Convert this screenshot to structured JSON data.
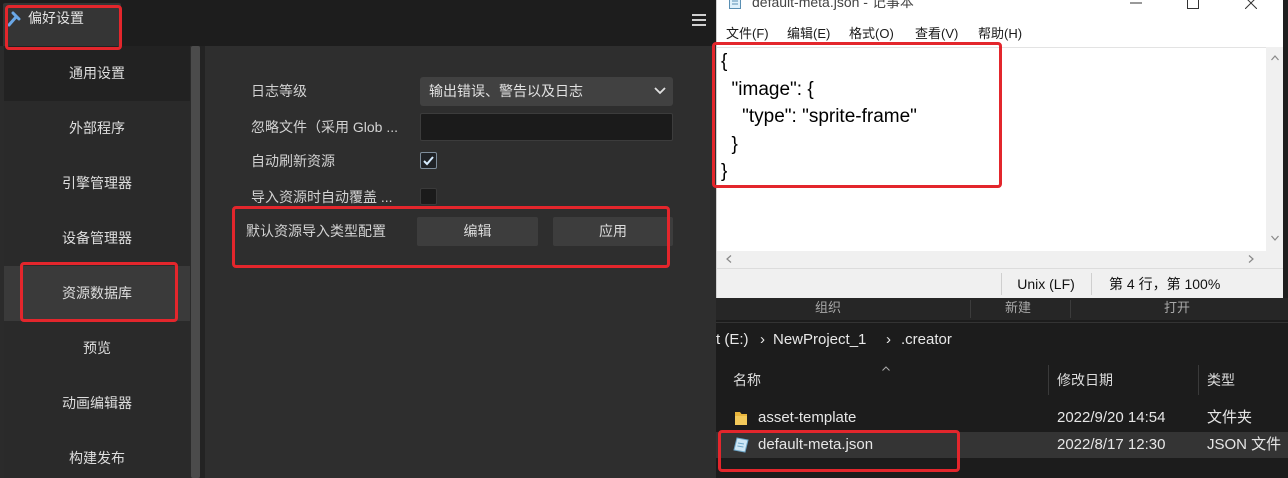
{
  "app": {
    "tab_title": "偏好设置",
    "tab_icon": "wrench-icon",
    "menu_icon": "hamburger-icon"
  },
  "sidebar": {
    "items": [
      {
        "label": "通用设置",
        "hovered": true
      },
      {
        "label": "外部程序"
      },
      {
        "label": "引擎管理器"
      },
      {
        "label": "设备管理器"
      },
      {
        "label": "资源数据库",
        "selected": true
      },
      {
        "label": "预览"
      },
      {
        "label": "动画编辑器"
      },
      {
        "label": "构建发布"
      }
    ]
  },
  "settings": {
    "log_level": {
      "label": "日志等级",
      "value": "输出错误、警告以及日志"
    },
    "ignore_files": {
      "label": "忽略文件（采用 Glob ...",
      "value": ""
    },
    "auto_refresh": {
      "label": "自动刷新资源",
      "checked": true
    },
    "auto_overwrite": {
      "label": "导入资源时自动覆盖 ...",
      "checked": false
    },
    "default_import": {
      "label": "默认资源导入类型配置",
      "edit_label": "编辑",
      "apply_label": "应用"
    }
  },
  "notepad": {
    "title": "default-meta.json - 记事本",
    "menu": [
      "文件(F)",
      "编辑(E)",
      "格式(O)",
      "查看(V)",
      "帮助(H)"
    ],
    "content_lines": [
      "{",
      "  \"image\": {",
      "    \"type\": \"sprite-frame\"",
      "  }",
      "}"
    ],
    "status": {
      "line_ending": "Unix (LF)",
      "position": "第 4 行，第 100%"
    }
  },
  "explorer": {
    "ribbon_groups": [
      "组织",
      "新建",
      "打开"
    ],
    "address": {
      "parts": [
        "t (E:)",
        "NewProject_1",
        ".creator"
      ],
      "separator": "›"
    },
    "columns": [
      "名称",
      "修改日期",
      "类型"
    ],
    "files": [
      {
        "name": "asset-template",
        "modified": "2022/9/20 14:54",
        "type": "文件夹",
        "icon": "folder-icon"
      },
      {
        "name": "default-meta.json",
        "modified": "2022/8/17 12:30",
        "type": "JSON 文件",
        "icon": "json-file-icon",
        "selected": true
      }
    ]
  },
  "colors": {
    "annotation": "#e3262c",
    "panel_bg": "#2e2e2e",
    "sidebar_selected": "#3a3a3a",
    "notepad_bg": "#ffffff",
    "explorer_bg": "#1c1c1c",
    "folder": "#e8b53c"
  }
}
